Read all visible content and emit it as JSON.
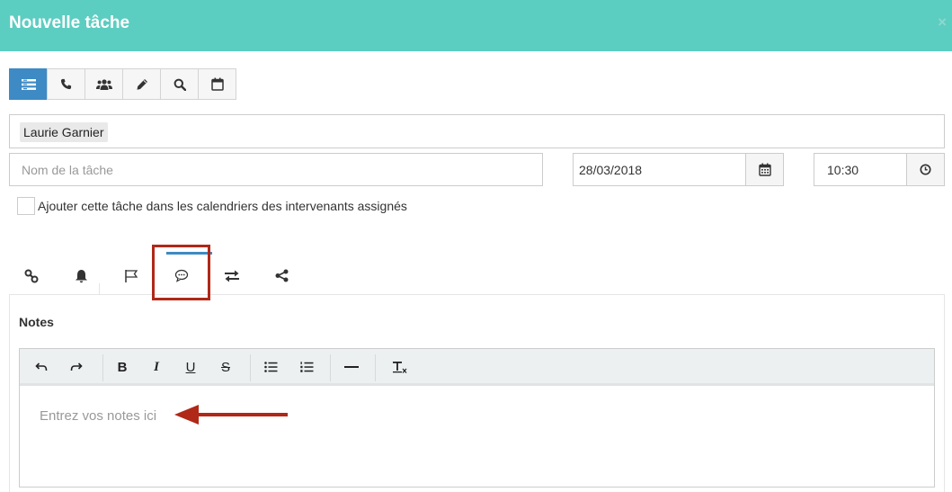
{
  "dialog": {
    "title": "Nouvelle tâche",
    "close_symbol": "×"
  },
  "task_types": [
    {
      "icon": "list-icon",
      "active": true
    },
    {
      "icon": "phone-icon",
      "active": false
    },
    {
      "icon": "group-icon",
      "active": false
    },
    {
      "icon": "pencil-icon",
      "active": false
    },
    {
      "icon": "search-icon",
      "active": false
    },
    {
      "icon": "calendar-icon",
      "active": false
    }
  ],
  "assignee": {
    "name": "Laurie Garnier"
  },
  "task_name": {
    "value": "",
    "placeholder": "Nom de la tâche"
  },
  "due_date": {
    "value": "28/03/2018",
    "icon": "calendar-icon"
  },
  "due_time": {
    "value": "10:30",
    "icon": "clock-icon"
  },
  "calendar_option": {
    "label": "Ajouter cette tâche dans les calendriers des intervenants assignés",
    "checked": false
  },
  "detail_tabs": [
    {
      "icon": "link-icon",
      "active": false
    },
    {
      "icon": "bell-icon",
      "active": false
    },
    {
      "icon": "flag-icon",
      "active": false
    },
    {
      "icon": "comment-icon",
      "active": true
    },
    {
      "icon": "exchange-icon",
      "active": false
    },
    {
      "icon": "share-icon",
      "active": false
    }
  ],
  "notes": {
    "title": "Notes",
    "placeholder": "Entrez vos notes ici",
    "toolbar": {
      "undo_icon": "undo-icon",
      "redo_icon": "redo-icon",
      "bold": "B",
      "italic": "I",
      "underline": "U",
      "strike": "S",
      "bullet_list_icon": "bullet-list-icon",
      "numbered_list_icon": "numbered-list-icon",
      "hr_icon": "horizontal-rule-icon",
      "clear_format_icon": "clear-format-icon"
    }
  },
  "colors": {
    "header": "#5ccdc1",
    "accent": "#3d8ac4",
    "annotation": "#b02818"
  }
}
